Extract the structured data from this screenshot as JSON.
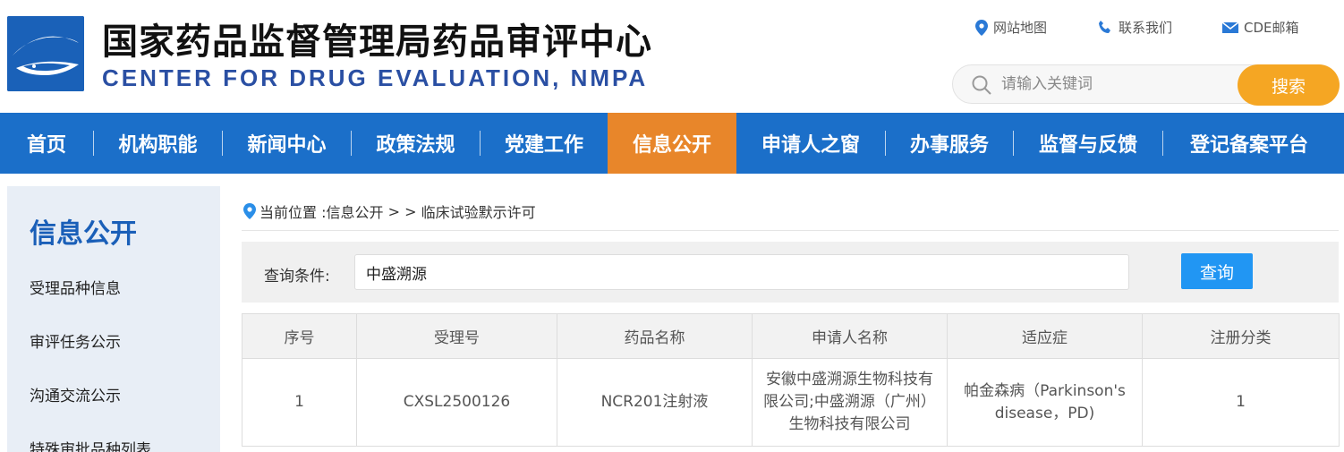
{
  "header": {
    "title_cn": "国家药品监督管理局药品审评中心",
    "title_en": "CENTER FOR DRUG EVALUATION, NMPA",
    "links": [
      {
        "label": "网站地图",
        "icon": "location-pin-icon"
      },
      {
        "label": "联系我们",
        "icon": "phone-icon"
      },
      {
        "label": "CDE邮箱",
        "icon": "mail-icon"
      }
    ],
    "search": {
      "placeholder": "请输入关键词",
      "value": "",
      "button": "搜索"
    }
  },
  "nav": {
    "items": [
      {
        "label": "首页"
      },
      {
        "label": "机构职能"
      },
      {
        "label": "新闻中心"
      },
      {
        "label": "政策法规"
      },
      {
        "label": "党建工作"
      },
      {
        "label": "信息公开",
        "active": true
      },
      {
        "label": "申请人之窗"
      },
      {
        "label": "办事服务"
      },
      {
        "label": "监督与反馈"
      },
      {
        "label": "登记备案平台"
      }
    ]
  },
  "sidebar": {
    "title": "信息公开",
    "items": [
      {
        "label": "受理品种信息"
      },
      {
        "label": "审评任务公示"
      },
      {
        "label": "沟通交流公示"
      },
      {
        "label": "特殊审批品种列表"
      }
    ]
  },
  "breadcrumb": {
    "prefix": "当前位置 : ",
    "section": "信息公开",
    "separator": " > > ",
    "page": "临床试验默示许可"
  },
  "query": {
    "label": "查询条件:",
    "value": "中盛溯源",
    "button": "查询"
  },
  "table": {
    "headers": [
      "序号",
      "受理号",
      "药品名称",
      "申请人名称",
      "适应症",
      "注册分类"
    ],
    "rows": [
      [
        "1",
        "CXSL2500126",
        "NCR201注射液",
        "安徽中盛溯源生物科技有限公司;中盛溯源（广州）生物科技有限公司",
        "帕金森病（Parkinson's disease，PD)",
        "1"
      ]
    ]
  },
  "colors": {
    "nav_bg": "#1b6fc9",
    "nav_active": "#e8862a",
    "search_button": "#f5a623",
    "query_button": "#2196f3",
    "sidebar_title": "#1a5fb8"
  }
}
